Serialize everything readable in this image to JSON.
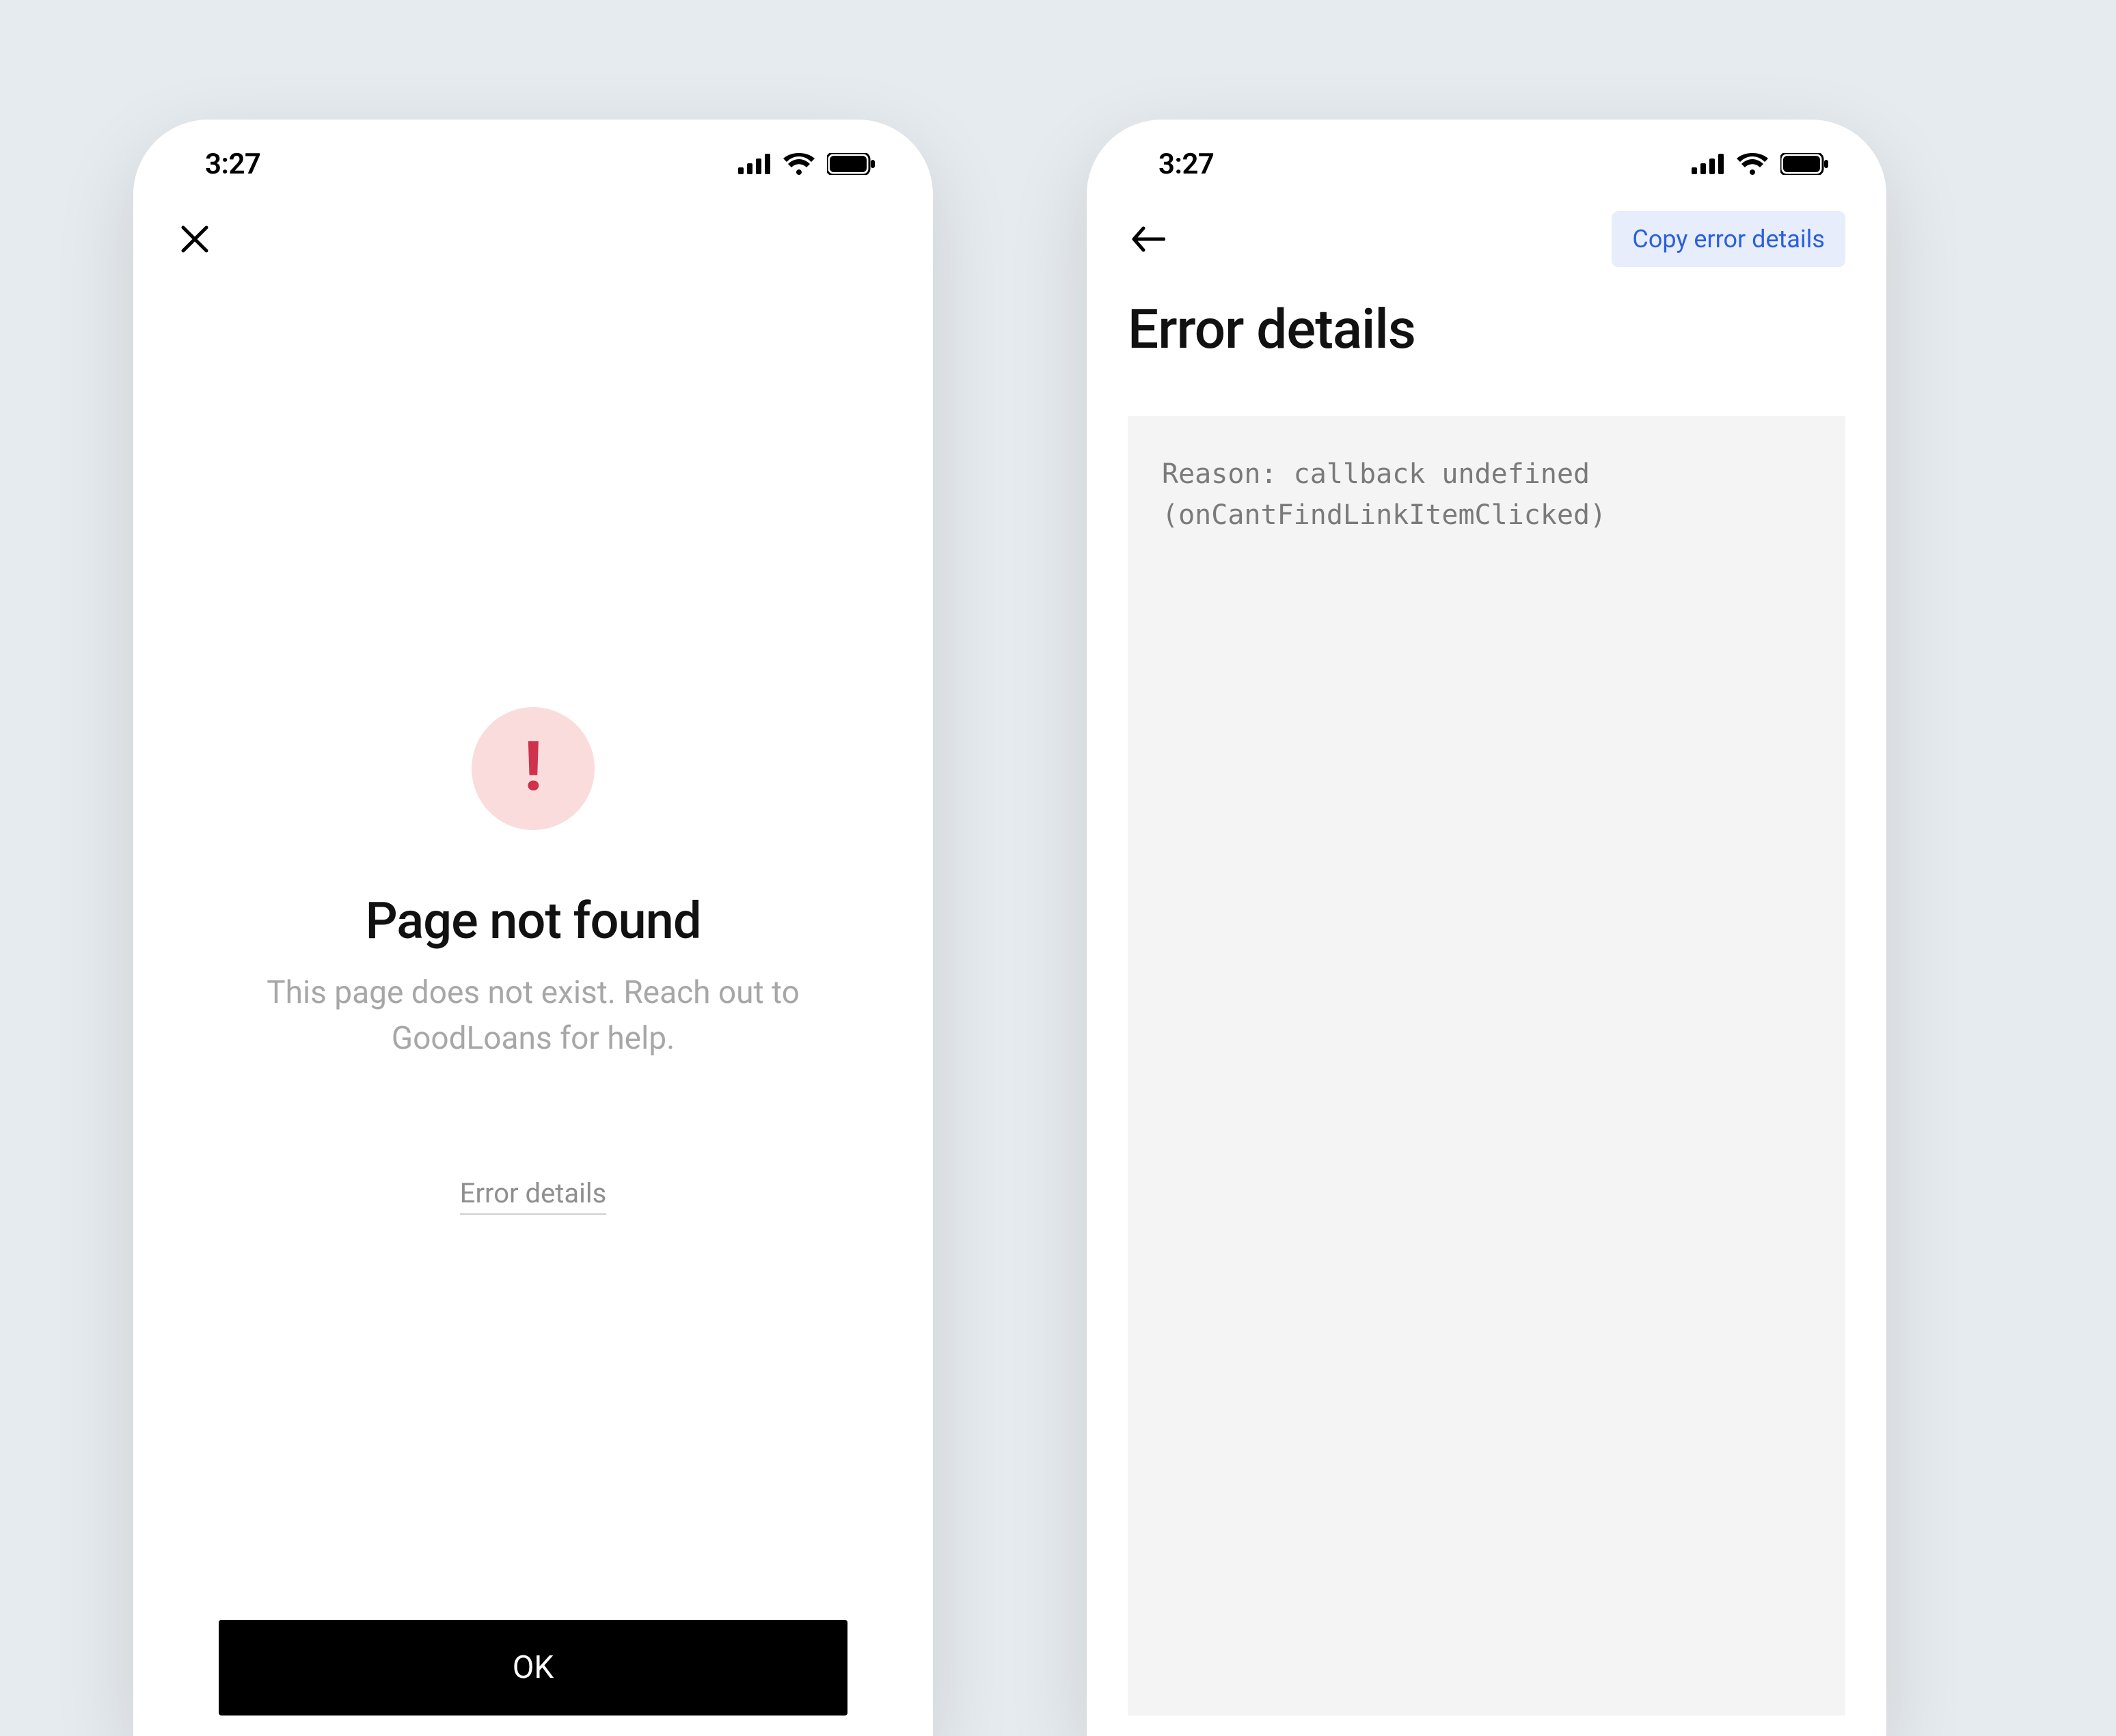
{
  "status": {
    "time": "3:27"
  },
  "screenA": {
    "title": "Page not found",
    "subtitle": "This page does not exist. Reach out to GoodLoans for help.",
    "details_link": "Error details",
    "ok_label": "OK",
    "bang": "!"
  },
  "screenB": {
    "copy_label": "Copy error details",
    "title": "Error details",
    "code": "Reason: callback undefined (onCantFindLinkItemClicked)"
  }
}
